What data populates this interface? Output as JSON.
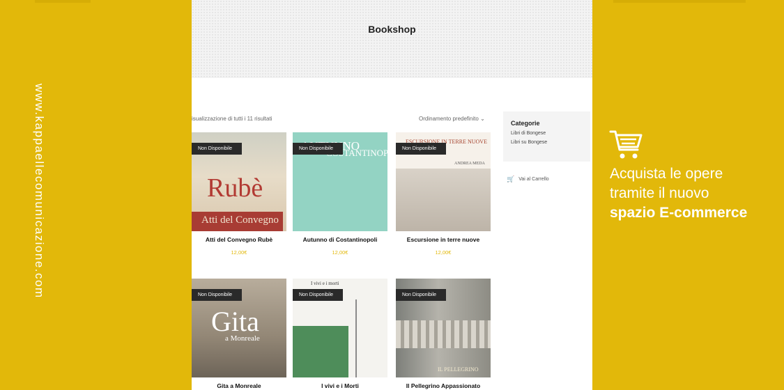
{
  "website": "www.kappaellecomunicazione.com",
  "shop": {
    "title": "Bookshop",
    "results_text": "isualizzazione di tutti i 11 risultati",
    "sort_text": "Ordinamento predefinito"
  },
  "sidebar": {
    "title": "Categorie",
    "categories": [
      "Libri di Bongese",
      "Libri su Bongese"
    ],
    "cart_link": "Vai al Carrello"
  },
  "products": [
    {
      "name": "Atti del Convegno Rubè",
      "price": "12,00€",
      "badge": "Non Disponibile",
      "cover_text": "Rubè",
      "cover_sub": "Atti del Convegno"
    },
    {
      "name": "Autunno di Costantinopoli",
      "price": "12,00€",
      "badge": "Non Disponibile",
      "cover_text": "AUTUNNO",
      "cover_sub": "COSTANTINOPOLI"
    },
    {
      "name": "Escursione in terre nuove",
      "price": "12,00€",
      "badge": "Non Disponibile",
      "cover_text": "ESCURSIONE IN TERRE NUOVE",
      "cover_sub": "ANDREA MEDA"
    },
    {
      "name": "Gita a Monreale",
      "price": "",
      "badge": "Non Disponibile",
      "cover_text": "Gita",
      "cover_sub": "a Monreale"
    },
    {
      "name": "I vivi e i Morti",
      "price": "",
      "badge": "Non Disponibile",
      "cover_text": "I vivi e i morti",
      "cover_sub": ""
    },
    {
      "name": "Il Pellegrino Appassionato",
      "price": "",
      "badge": "Non Disponibile",
      "cover_text": "IL PELLEGRINO",
      "cover_sub": ""
    }
  ],
  "promo": {
    "line1": "Acquista le opere",
    "line2": "tramite il nuovo",
    "line3": "spazio E-commerce"
  },
  "colors": {
    "background": "#E2B80A",
    "badge": "#2a2a2a",
    "price": "#E2B80A"
  }
}
